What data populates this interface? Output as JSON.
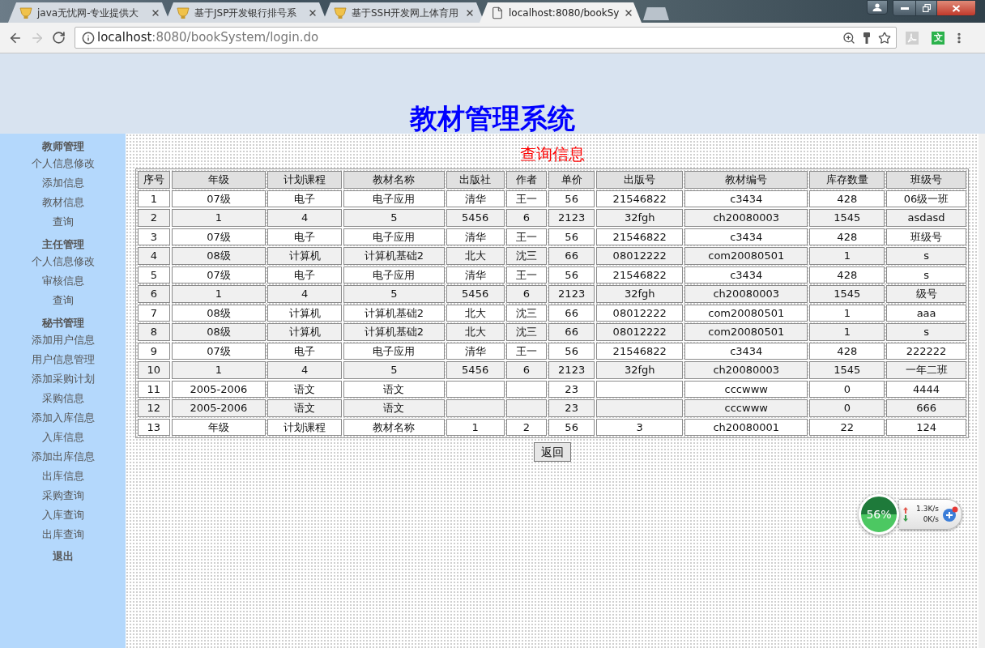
{
  "browser": {
    "tabs": [
      {
        "title": "java无忧网-专业提供大",
        "kind": "site",
        "selected": false
      },
      {
        "title": "基于JSP开发银行排号系",
        "kind": "site",
        "selected": false
      },
      {
        "title": "基于SSH开发网上体育用",
        "kind": "site",
        "selected": false
      },
      {
        "title": "localhost:8080/bookSy",
        "kind": "default",
        "selected": true
      }
    ],
    "forward_disabled": true,
    "url": {
      "host": "localhost",
      "path": ":8080/bookSystem/login.do"
    },
    "extensions": [
      {
        "kind": "pdf"
      },
      {
        "kind": "translate",
        "label": "文"
      }
    ]
  },
  "header": {
    "title": "教材管理系统"
  },
  "sidebar": {
    "sections": [
      {
        "title": "教师管理",
        "links": [
          "个人信息修改",
          "添加信息",
          "教材信息",
          "查询"
        ]
      },
      {
        "title": "主任管理",
        "links": [
          "个人信息修改",
          "审核信息",
          "查询"
        ]
      },
      {
        "title": "秘书管理",
        "links": [
          "添加用户信息",
          "用户信息管理",
          "添加采购计划",
          "采购信息",
          "添加入库信息",
          "入库信息",
          "添加出库信息",
          "出库信息",
          "采购查询",
          "入库查询",
          "出库查询"
        ]
      }
    ],
    "logout": "退出"
  },
  "main": {
    "title": "查询信息",
    "table": {
      "columns": [
        "序号",
        "年级",
        "计划课程",
        "教材名称",
        "出版社",
        "作者",
        "单价",
        "出版号",
        "教材编号",
        "库存数量",
        "班级号"
      ],
      "rows": [
        [
          "1",
          "07级",
          "电子",
          "电子应用",
          "清华",
          "王一",
          "56",
          "21546822",
          "c3434",
          "428",
          "06级一班"
        ],
        [
          "2",
          "1",
          "4",
          "5",
          "5456",
          "6",
          "2123",
          "32fgh",
          "ch20080003",
          "1545",
          "asdasd"
        ],
        [
          "3",
          "07级",
          "电子",
          "电子应用",
          "清华",
          "王一",
          "56",
          "21546822",
          "c3434",
          "428",
          "班级号"
        ],
        [
          "4",
          "08级",
          "计算机",
          "计算机基础2",
          "北大",
          "沈三",
          "66",
          "08012222",
          "com20080501",
          "1",
          "s"
        ],
        [
          "5",
          "07级",
          "电子",
          "电子应用",
          "清华",
          "王一",
          "56",
          "21546822",
          "c3434",
          "428",
          "s"
        ],
        [
          "6",
          "1",
          "4",
          "5",
          "5456",
          "6",
          "2123",
          "32fgh",
          "ch20080003",
          "1545",
          "级号"
        ],
        [
          "7",
          "08级",
          "计算机",
          "计算机基础2",
          "北大",
          "沈三",
          "66",
          "08012222",
          "com20080501",
          "1",
          "aaa"
        ],
        [
          "8",
          "08级",
          "计算机",
          "计算机基础2",
          "北大",
          "沈三",
          "66",
          "08012222",
          "com20080501",
          "1",
          "s"
        ],
        [
          "9",
          "07级",
          "电子",
          "电子应用",
          "清华",
          "王一",
          "56",
          "21546822",
          "c3434",
          "428",
          "222222"
        ],
        [
          "10",
          "1",
          "4",
          "5",
          "5456",
          "6",
          "2123",
          "32fgh",
          "ch20080003",
          "1545",
          "一年二班"
        ],
        [
          "11",
          "2005-2006",
          "语文",
          "语文",
          null,
          null,
          "23",
          null,
          "cccwww",
          "0",
          "4444"
        ],
        [
          "12",
          "2005-2006",
          "语文",
          "语文",
          null,
          null,
          "23",
          null,
          "cccwww",
          "0",
          "666"
        ],
        [
          "13",
          "年级",
          "计划课程",
          "教材名称",
          "1",
          "2",
          "56",
          "3",
          "ch20080001",
          "22",
          "124"
        ]
      ]
    },
    "back_button": "返回"
  },
  "net_monitor": {
    "memory": "56%",
    "upload": "1.3K/s",
    "download": "0K/s"
  }
}
